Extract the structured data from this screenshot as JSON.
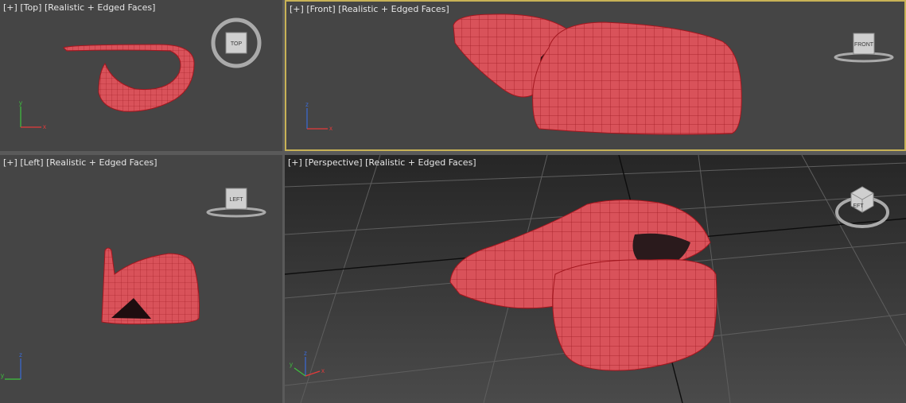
{
  "viewports": {
    "top": {
      "plus": "[+]",
      "view": "[Top]",
      "shading": "[Realistic + Edged Faces]",
      "cube_label": "TOP"
    },
    "front": {
      "plus": "[+]",
      "view": "[Front]",
      "shading": "[Realistic + Edged Faces]",
      "cube_label": "FRONT"
    },
    "left": {
      "plus": "[+]",
      "view": "[Left]",
      "shading": "[Realistic + Edged Faces]",
      "cube_label": "LEFT"
    },
    "perspective": {
      "plus": "[+]",
      "view": "[Perspective]",
      "shading": "[Realistic + Edged Faces]",
      "cube_label": "LEFT"
    }
  },
  "axes": {
    "x": "x",
    "y": "y",
    "z": "z"
  },
  "colors": {
    "mesh_fill": "#d9525a",
    "mesh_edge": "#a3161e",
    "active_border": "#c8b256",
    "viewport_bg": "#454545",
    "perspective_bg": "#2e2e2e"
  }
}
